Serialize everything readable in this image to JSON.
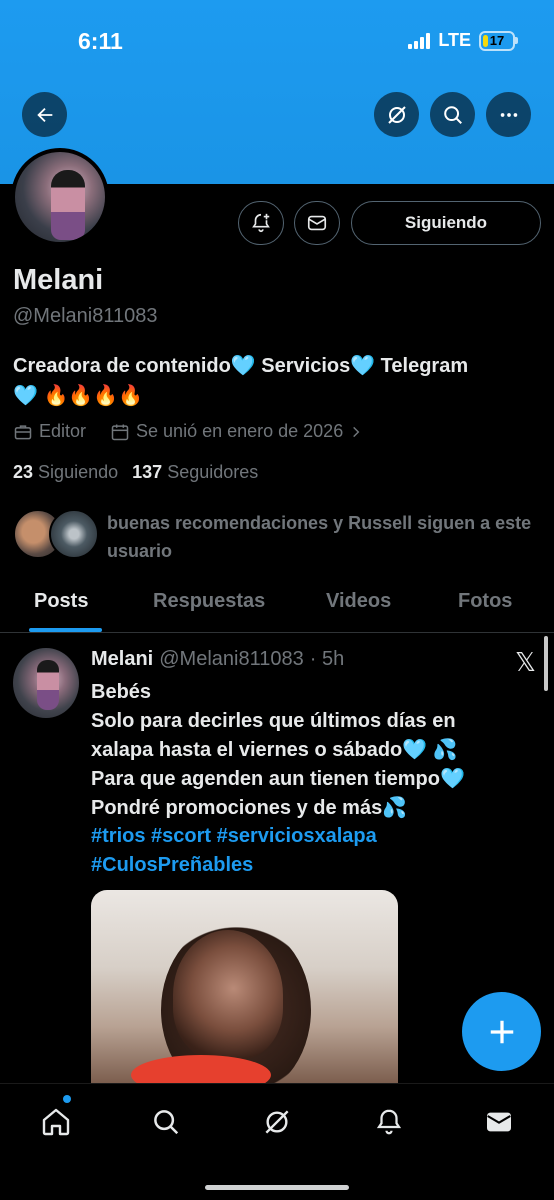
{
  "status_bar": {
    "time": "6:11",
    "network": "LTE",
    "battery": "17",
    "battery_level": 0.17
  },
  "header": {
    "back_icon": "arrow-left-icon",
    "grok_icon": "grok-icon",
    "search_icon": "search-icon",
    "more_icon": "more-icon"
  },
  "profile": {
    "name": "Melani",
    "handle": "@Melani811083",
    "bio_line1": "Creadora de contenido🩵 Servicios🩵 Telegram",
    "bio_line2": "🩵 🔥🔥🔥🔥",
    "category": "Editor",
    "joined": "Se unió en enero de 2026",
    "following_count": "23",
    "following_label": "Siguiendo",
    "followers_count": "137",
    "followers_label": "Seguidores",
    "mutuals_text": "buenas recomendaciones y Russell siguen a este usuario",
    "follow_button": "Siguiendo"
  },
  "tabs": [
    {
      "label": "Posts",
      "active": true
    },
    {
      "label": "Respuestas",
      "active": false
    },
    {
      "label": "Videos",
      "active": false
    },
    {
      "label": "Fotos",
      "active": false
    }
  ],
  "post": {
    "author": "Melani",
    "handle": "@Melani811083",
    "time": "· 5h",
    "line1": "Bebés",
    "line2": "Solo para decirles que últimos días en",
    "line3": "xalapa hasta el viernes o sábado🩵 💦",
    "line4": "Para que agenden aun tienen tiempo🩵",
    "line5": "Pondré promociones y de más💦",
    "tags1": "#trios #scort #serviciosxalapa",
    "tags2": "#CulosPreñables",
    "x_logo": "𝕏"
  },
  "bottom_nav": [
    "home-icon",
    "search-icon",
    "grok-icon",
    "notifications-icon",
    "messages-icon"
  ],
  "colors": {
    "accent": "#1d9bf0",
    "background": "#000000",
    "text": "#e7e9ea",
    "muted": "#71767b"
  }
}
